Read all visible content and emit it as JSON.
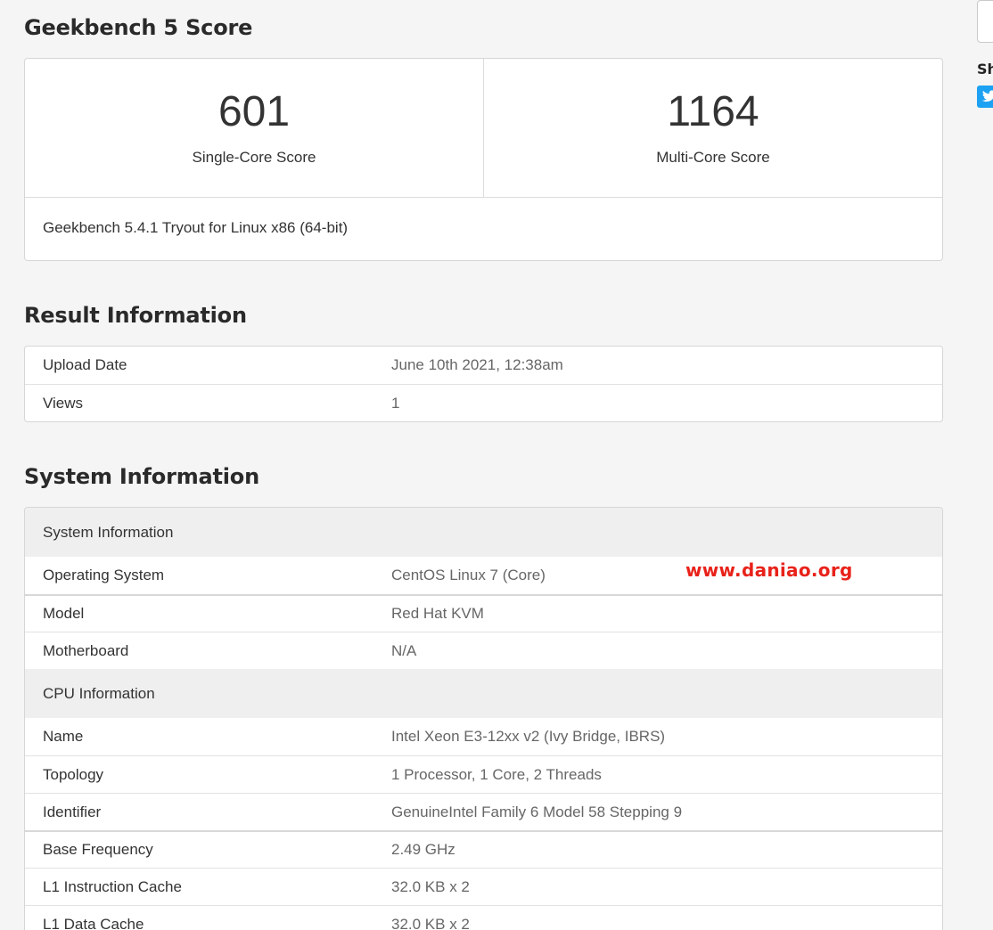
{
  "score_section": {
    "title": "Geekbench 5 Score",
    "single_core_value": "601",
    "single_core_label": "Single-Core Score",
    "multi_core_value": "1164",
    "multi_core_label": "Multi-Core Score",
    "version": "Geekbench 5.4.1 Tryout for Linux x86 (64-bit)"
  },
  "result_section": {
    "title": "Result Information",
    "rows": [
      {
        "key": "Upload Date",
        "value": "June 10th 2021, 12:38am"
      },
      {
        "key": "Views",
        "value": "1"
      }
    ]
  },
  "system_section": {
    "title": "System Information",
    "system_header": "System Information",
    "system_rows": [
      {
        "key": "Operating System",
        "value": "CentOS Linux 7 (Core)"
      },
      {
        "key": "Model",
        "value": "Red Hat KVM"
      },
      {
        "key": "Motherboard",
        "value": "N/A"
      }
    ],
    "cpu_header": "CPU Information",
    "cpu_rows": [
      {
        "key": "Name",
        "value": "Intel Xeon E3-12xx v2 (Ivy Bridge, IBRS)"
      },
      {
        "key": "Topology",
        "value": "1 Processor, 1 Core, 2 Threads"
      },
      {
        "key": "Identifier",
        "value": "GenuineIntel Family 6 Model 58 Stepping 9"
      },
      {
        "key": "Base Frequency",
        "value": "2.49 GHz"
      },
      {
        "key": "L1 Instruction Cache",
        "value": "32.0 KB x 2"
      },
      {
        "key": "L1 Data Cache",
        "value": "32.0 KB x 2"
      }
    ]
  },
  "watermark": "www.daniao.org",
  "sidebar": {
    "share_label": "Sh",
    "twitter_icon": "twitter-icon"
  },
  "colors": {
    "watermark": "#e8221a",
    "twitter": "#1da1f2",
    "group_header_bg": "#efefef"
  }
}
